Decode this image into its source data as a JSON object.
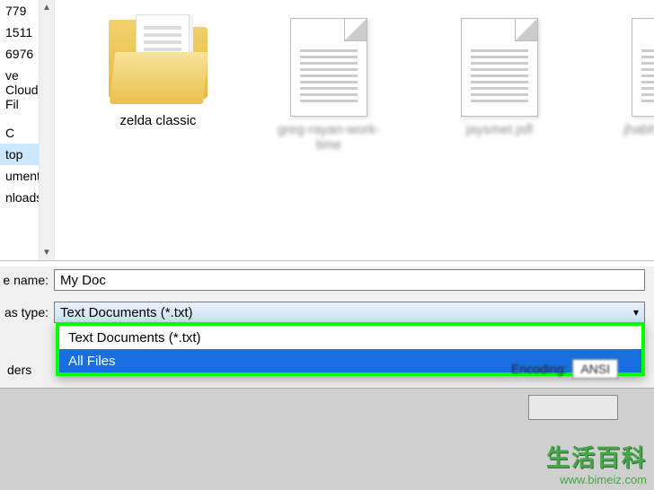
{
  "sidebar": {
    "items": [
      {
        "label": "779"
      },
      {
        "label": "1511"
      },
      {
        "label": "6976"
      },
      {
        "label": "ve Cloud Fil"
      },
      {
        "label": ""
      },
      {
        "label": "C"
      },
      {
        "label": "top"
      },
      {
        "label": "uments"
      },
      {
        "label": "nloads"
      }
    ],
    "selected_index": 6
  },
  "files": {
    "items": [
      {
        "name": "zelda classic",
        "type": "folder"
      },
      {
        "name": "greg-rayan-work-time",
        "type": "doc",
        "blurred": true
      },
      {
        "name": "jaysmet.jsfl",
        "type": "doc",
        "blurred": true
      },
      {
        "name": "jhabhai-ra-RTG",
        "type": "doc",
        "blurred": true
      }
    ]
  },
  "form": {
    "filename_label": "e name:",
    "filename_value": "My Doc",
    "type_label": "as type:",
    "type_value": "Text Documents (*.txt)",
    "dropdown": {
      "items": [
        {
          "label": "Text Documents (*.txt)"
        },
        {
          "label": "All Files"
        }
      ],
      "selected_index": 1
    },
    "encoding_label": "Encoding:",
    "encoding_value": "ANSI",
    "folders_label": "ders"
  },
  "watermark": {
    "line1": "生活百科",
    "line2": "www.bimeiz.com"
  }
}
